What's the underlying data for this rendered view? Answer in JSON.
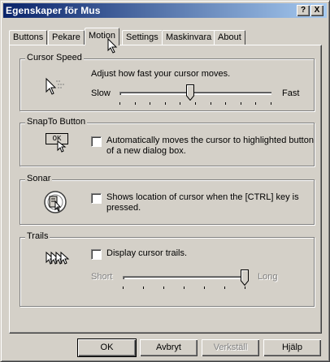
{
  "window": {
    "title": "Egenskaper för Mus",
    "help_label": "?",
    "close_label": "X"
  },
  "tabs": [
    {
      "label": "Buttons",
      "active": false
    },
    {
      "label": "Pekare",
      "active": false
    },
    {
      "label": "Motion",
      "active": true
    },
    {
      "label": "Settings",
      "active": false
    },
    {
      "label": "Maskinvara",
      "active": false
    },
    {
      "label": "About",
      "active": false
    }
  ],
  "cursor_speed": {
    "title": "Cursor Speed",
    "description": "Adjust how fast your cursor moves.",
    "min_label": "Slow",
    "max_label": "Fast",
    "value_fraction": 0.47
  },
  "snapto": {
    "title": "SnapTo Button",
    "icon_label": "OK",
    "checkbox_label_line1": "Automatically moves the cursor to highlighted button",
    "checkbox_label_line2": "of a new dialog box.",
    "checked": false
  },
  "sonar": {
    "title": "Sonar",
    "checkbox_label_line1": "Shows location of cursor when the [CTRL] key is",
    "checkbox_label_line2": "pressed.",
    "checked": false
  },
  "trails": {
    "title": "Trails",
    "checkbox_label": "Display cursor trails.",
    "checked": false,
    "min_label": "Short",
    "max_label": "Long",
    "value_fraction": 1.0,
    "enabled": false
  },
  "buttons": {
    "ok": "OK",
    "cancel": "Avbryt",
    "apply": "Verkställ",
    "help": "Hjälp"
  }
}
